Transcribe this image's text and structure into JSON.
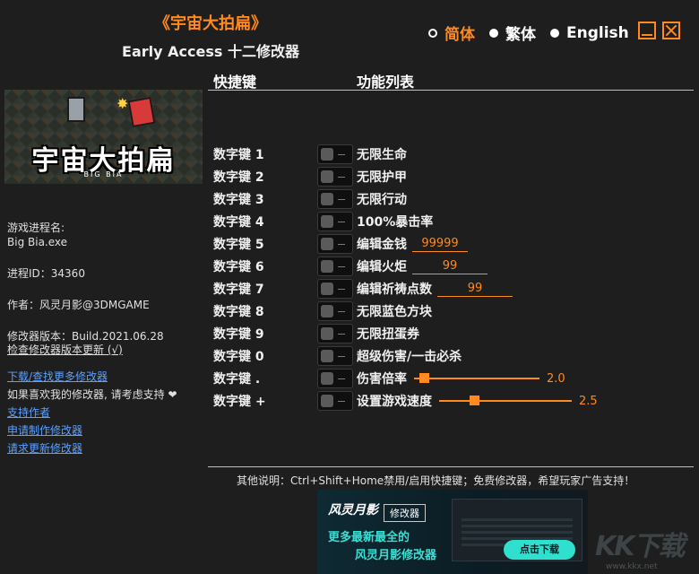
{
  "header": {
    "title": "《宇宙大拍扁》",
    "subtitle": "Early Access 十二修改器"
  },
  "languages": [
    {
      "label": "简体",
      "active": true
    },
    {
      "label": "繁体",
      "active": false
    },
    {
      "label": "English",
      "active": false
    }
  ],
  "cover": {
    "title": "宇宙大拍扁",
    "subtitle": "BIG BIA"
  },
  "info": {
    "process_label": "游戏进程名:",
    "process_value": "Big Bia.exe",
    "pid": "进程ID：34360",
    "author": "作者：风灵月影@3DMGAME",
    "version": "修改器版本：Build.2021.06.28",
    "check_update": "检查修改器版本更新 (√)",
    "download_link": "下载/查找更多修改器",
    "support_text": "如果喜欢我的修改器, 请考虑支持 ❤",
    "support_link": "支持作者",
    "request_link": "申请制作修改器",
    "update_request_link": "请求更新修改器"
  },
  "columns": {
    "hotkey": "快捷键",
    "features": "功能列表"
  },
  "cheats": [
    {
      "key": "数字键 1",
      "label": "无限生命"
    },
    {
      "key": "数字键 2",
      "label": "无限护甲"
    },
    {
      "key": "数字键 3",
      "label": "无限行动"
    },
    {
      "key": "数字键 4",
      "label": "100%暴击率"
    },
    {
      "key": "数字键 5",
      "label": "编辑金钱",
      "value": "99999"
    },
    {
      "key": "数字键 6",
      "label": "编辑火炬",
      "value": "99"
    },
    {
      "key": "数字键 7",
      "label": "编辑祈祷点数",
      "value": "99"
    },
    {
      "key": "数字键 8",
      "label": "无限蓝色方块"
    },
    {
      "key": "数字键 9",
      "label": "无限扭蛋券"
    },
    {
      "key": "数字键 0",
      "label": "超级伤害/一击必杀"
    },
    {
      "key": "数字键 .",
      "label": "伤害倍率",
      "slider_value": "2.0",
      "slider_fraction": 0.05
    },
    {
      "key": "数字键 +",
      "label": "设置游戏速度",
      "slider_value": "2.5",
      "slider_fraction": 0.25
    }
  ],
  "footer": {
    "note": "其他说明：Ctrl+Shift+Home禁用/启用快捷键；免费修改器，希望玩家广告支持！"
  },
  "banner": {
    "logo": "风灵月影",
    "tag": "修改器",
    "line1": "更多最新最全的",
    "line2": "风灵月影修改器",
    "button": "点击下载"
  },
  "watermark": {
    "text": "KK下载",
    "url": "www.kkx.net"
  },
  "colors": {
    "accent": "#ff8a1f",
    "background": "#1e1e1e",
    "link": "#5aa0ff",
    "banner_accent": "#38e0d4"
  }
}
